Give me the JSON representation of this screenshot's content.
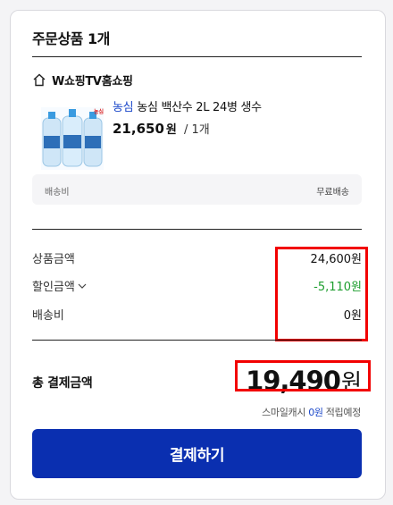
{
  "order": {
    "section_title": "주문상품 1개",
    "shop_name": "W쇼핑TV홈쇼핑",
    "brand_mark": "농심",
    "product": {
      "brand": "농심",
      "name": "농심 백산수 2L 24병 생수",
      "price": "21,650",
      "price_unit": "원",
      "quantity": "/ 1개"
    },
    "shipping": {
      "label": "배송비",
      "value": "무료배송"
    }
  },
  "summary": {
    "product_amount_label": "상품금액",
    "product_amount": "24,600원",
    "discount_label": "할인금액",
    "discount_amount": "-5,110원",
    "shipping_label": "배송비",
    "shipping_amount": "0원"
  },
  "total": {
    "label": "총 결제금액",
    "amount": "19,490",
    "unit": "원",
    "points_prefix": "스마일캐시",
    "points_amount": "0원",
    "points_suffix": "적립예정"
  },
  "pay_button_label": "결제하기",
  "colors": {
    "primary": "#0a2fb0",
    "discount": "#1e9e2f",
    "highlight": "#f20000",
    "link": "#1a47c9"
  },
  "icons": {
    "shop": "home-icon",
    "discount_toggle": "chevron-down-icon"
  }
}
